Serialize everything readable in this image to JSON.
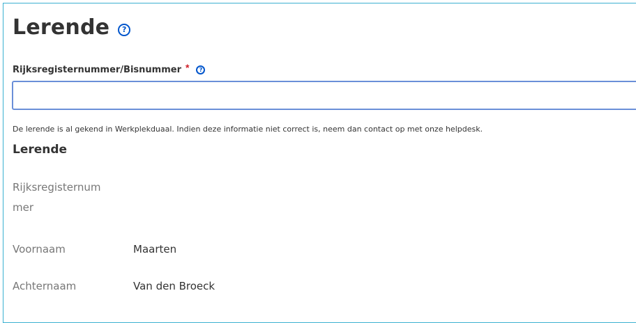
{
  "section": {
    "title": "Lerende",
    "help_icon": "help-circle-icon"
  },
  "field": {
    "label": "Rijksregisternummer/Bisnummer",
    "required_marker": "*",
    "help_icon": "help-circle-icon",
    "value": "",
    "placeholder": ""
  },
  "info_message": "De lerende is al gekend in Werkplekduaal. Indien deze informatie niet correct is, neem dan contact op met onze helpdesk.",
  "details": {
    "title": "Lerende",
    "rows": [
      {
        "label": "Rijksregisternum\nmer",
        "label_line1": "Rijksregisternum",
        "label_line2": "mer",
        "value": ""
      },
      {
        "label": "Voornaam",
        "value": "Maarten"
      },
      {
        "label": "Achternaam",
        "value": "Van den Broeck"
      }
    ]
  },
  "colors": {
    "panel_border": "#3ab0d1",
    "input_border": "#6a8fd8",
    "help_icon": "#0055cc",
    "required": "#d0202a",
    "label_muted": "#777777",
    "text": "#333333"
  }
}
